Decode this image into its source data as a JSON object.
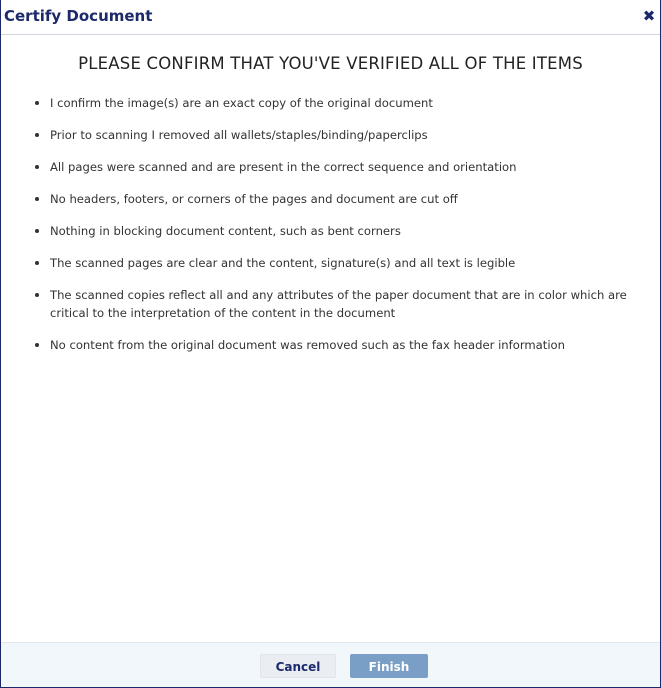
{
  "dialog": {
    "title": "Certify Document",
    "close_icon": "close-icon",
    "heading": "PLEASE CONFIRM THAT YOU'VE VERIFIED ALL OF THE ITEMS",
    "items": [
      "I confirm the image(s) are an exact copy of the original document",
      "Prior to scanning I removed all wallets/staples/binding/paperclips",
      "All pages were scanned and are present in the correct sequence and orientation",
      "No headers, footers, or corners of the pages and document are cut off",
      "Nothing in blocking document content, such as bent corners",
      "The scanned pages are clear and the content, signature(s) and all text is legible",
      "The scanned copies reflect all and any attributes of the paper document that are in color which are critical to the interpretation of the content in the document",
      "No content from the original document was removed such as the fax header information"
    ]
  },
  "footer": {
    "cancel_label": "Cancel",
    "finish_label": "Finish"
  },
  "colors": {
    "title": "#1c2a6b",
    "finish_button": "#7a9fc6",
    "footer_bg": "#f2f7fb"
  }
}
